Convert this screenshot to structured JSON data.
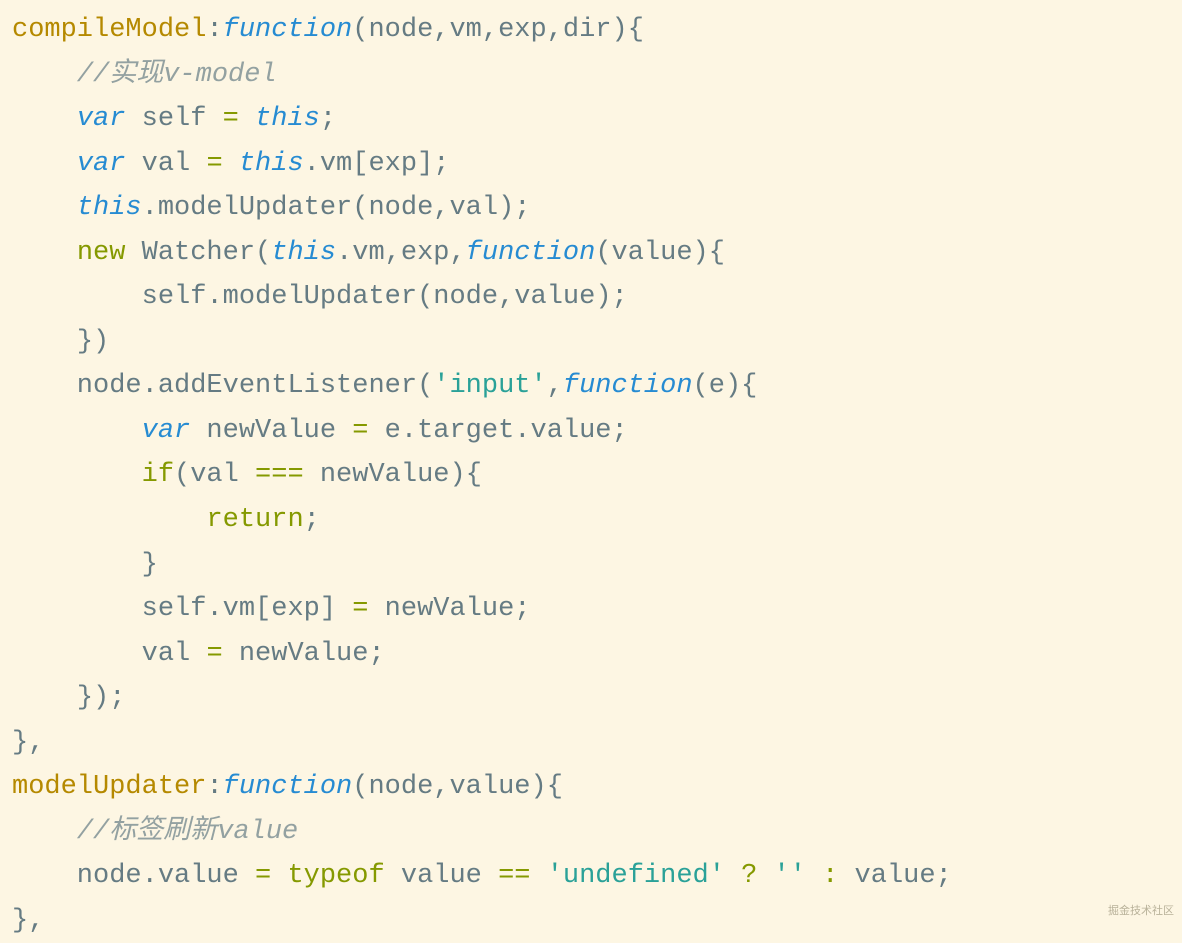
{
  "watermark": "掘金技术社区",
  "tokens": [
    [
      {
        "t": "compileModel",
        "c": "tk-prop"
      },
      {
        "t": ":",
        "c": "tk-pun"
      },
      {
        "t": "function",
        "c": "tk-fn"
      },
      {
        "t": "(",
        "c": "tk-pun"
      },
      {
        "t": "node",
        "c": "tk-name"
      },
      {
        "t": ",",
        "c": "tk-pun"
      },
      {
        "t": "vm",
        "c": "tk-name"
      },
      {
        "t": ",",
        "c": "tk-pun"
      },
      {
        "t": "exp",
        "c": "tk-name"
      },
      {
        "t": ",",
        "c": "tk-pun"
      },
      {
        "t": "dir",
        "c": "tk-name"
      },
      {
        "t": ")",
        "c": "tk-pun"
      },
      {
        "t": "{",
        "c": "tk-pun"
      }
    ],
    [
      {
        "t": "    ",
        "c": "tk-pun"
      },
      {
        "t": "//实现v-model",
        "c": "tk-cmt"
      }
    ],
    [
      {
        "t": "    ",
        "c": "tk-pun"
      },
      {
        "t": "var",
        "c": "tk-var"
      },
      {
        "t": " self ",
        "c": "tk-name"
      },
      {
        "t": "=",
        "c": "tk-kw"
      },
      {
        "t": " ",
        "c": "tk-pun"
      },
      {
        "t": "this",
        "c": "tk-this"
      },
      {
        "t": ";",
        "c": "tk-pun"
      }
    ],
    [
      {
        "t": "    ",
        "c": "tk-pun"
      },
      {
        "t": "var",
        "c": "tk-var"
      },
      {
        "t": " val ",
        "c": "tk-name"
      },
      {
        "t": "=",
        "c": "tk-kw"
      },
      {
        "t": " ",
        "c": "tk-pun"
      },
      {
        "t": "this",
        "c": "tk-this"
      },
      {
        "t": ".",
        "c": "tk-pun"
      },
      {
        "t": "vm",
        "c": "tk-name"
      },
      {
        "t": "[",
        "c": "tk-pun"
      },
      {
        "t": "exp",
        "c": "tk-name"
      },
      {
        "t": "]",
        "c": "tk-pun"
      },
      {
        "t": ";",
        "c": "tk-pun"
      }
    ],
    [
      {
        "t": "    ",
        "c": "tk-pun"
      },
      {
        "t": "this",
        "c": "tk-this"
      },
      {
        "t": ".",
        "c": "tk-pun"
      },
      {
        "t": "modelUpdater",
        "c": "tk-name"
      },
      {
        "t": "(",
        "c": "tk-pun"
      },
      {
        "t": "node",
        "c": "tk-name"
      },
      {
        "t": ",",
        "c": "tk-pun"
      },
      {
        "t": "val",
        "c": "tk-name"
      },
      {
        "t": ")",
        "c": "tk-pun"
      },
      {
        "t": ";",
        "c": "tk-pun"
      }
    ],
    [
      {
        "t": "    ",
        "c": "tk-pun"
      },
      {
        "t": "new",
        "c": "tk-kw"
      },
      {
        "t": " Watcher",
        "c": "tk-name"
      },
      {
        "t": "(",
        "c": "tk-pun"
      },
      {
        "t": "this",
        "c": "tk-this"
      },
      {
        "t": ".",
        "c": "tk-pun"
      },
      {
        "t": "vm",
        "c": "tk-name"
      },
      {
        "t": ",",
        "c": "tk-pun"
      },
      {
        "t": "exp",
        "c": "tk-name"
      },
      {
        "t": ",",
        "c": "tk-pun"
      },
      {
        "t": "function",
        "c": "tk-fn"
      },
      {
        "t": "(",
        "c": "tk-pun"
      },
      {
        "t": "value",
        "c": "tk-name"
      },
      {
        "t": ")",
        "c": "tk-pun"
      },
      {
        "t": "{",
        "c": "tk-pun"
      }
    ],
    [
      {
        "t": "        self",
        "c": "tk-name"
      },
      {
        "t": ".",
        "c": "tk-pun"
      },
      {
        "t": "modelUpdater",
        "c": "tk-name"
      },
      {
        "t": "(",
        "c": "tk-pun"
      },
      {
        "t": "node",
        "c": "tk-name"
      },
      {
        "t": ",",
        "c": "tk-pun"
      },
      {
        "t": "value",
        "c": "tk-name"
      },
      {
        "t": ")",
        "c": "tk-pun"
      },
      {
        "t": ";",
        "c": "tk-pun"
      }
    ],
    [
      {
        "t": "    ",
        "c": "tk-pun"
      },
      {
        "t": "}",
        "c": "tk-pun"
      },
      {
        "t": ")",
        "c": "tk-pun"
      }
    ],
    [
      {
        "t": "    node",
        "c": "tk-name"
      },
      {
        "t": ".",
        "c": "tk-pun"
      },
      {
        "t": "addEventListener",
        "c": "tk-name"
      },
      {
        "t": "(",
        "c": "tk-pun"
      },
      {
        "t": "'input'",
        "c": "tk-str"
      },
      {
        "t": ",",
        "c": "tk-pun"
      },
      {
        "t": "function",
        "c": "tk-fn"
      },
      {
        "t": "(",
        "c": "tk-pun"
      },
      {
        "t": "e",
        "c": "tk-name"
      },
      {
        "t": ")",
        "c": "tk-pun"
      },
      {
        "t": "{",
        "c": "tk-pun"
      }
    ],
    [
      {
        "t": "        ",
        "c": "tk-pun"
      },
      {
        "t": "var",
        "c": "tk-var"
      },
      {
        "t": " newValue ",
        "c": "tk-name"
      },
      {
        "t": "=",
        "c": "tk-kw"
      },
      {
        "t": " e",
        "c": "tk-name"
      },
      {
        "t": ".",
        "c": "tk-pun"
      },
      {
        "t": "target",
        "c": "tk-name"
      },
      {
        "t": ".",
        "c": "tk-pun"
      },
      {
        "t": "value",
        "c": "tk-name"
      },
      {
        "t": ";",
        "c": "tk-pun"
      }
    ],
    [
      {
        "t": "        ",
        "c": "tk-pun"
      },
      {
        "t": "if",
        "c": "tk-kw"
      },
      {
        "t": "(",
        "c": "tk-pun"
      },
      {
        "t": "val ",
        "c": "tk-name"
      },
      {
        "t": "===",
        "c": "tk-kw"
      },
      {
        "t": " newValue",
        "c": "tk-name"
      },
      {
        "t": ")",
        "c": "tk-pun"
      },
      {
        "t": "{",
        "c": "tk-pun"
      }
    ],
    [
      {
        "t": "            ",
        "c": "tk-pun"
      },
      {
        "t": "return",
        "c": "tk-kw"
      },
      {
        "t": ";",
        "c": "tk-pun"
      }
    ],
    [
      {
        "t": "        ",
        "c": "tk-pun"
      },
      {
        "t": "}",
        "c": "tk-pun"
      }
    ],
    [
      {
        "t": "        self",
        "c": "tk-name"
      },
      {
        "t": ".",
        "c": "tk-pun"
      },
      {
        "t": "vm",
        "c": "tk-name"
      },
      {
        "t": "[",
        "c": "tk-pun"
      },
      {
        "t": "exp",
        "c": "tk-name"
      },
      {
        "t": "]",
        "c": "tk-pun"
      },
      {
        "t": " ",
        "c": "tk-pun"
      },
      {
        "t": "=",
        "c": "tk-kw"
      },
      {
        "t": " newValue",
        "c": "tk-name"
      },
      {
        "t": ";",
        "c": "tk-pun"
      }
    ],
    [
      {
        "t": "        val ",
        "c": "tk-name"
      },
      {
        "t": "=",
        "c": "tk-kw"
      },
      {
        "t": " newValue",
        "c": "tk-name"
      },
      {
        "t": ";",
        "c": "tk-pun"
      }
    ],
    [
      {
        "t": "    ",
        "c": "tk-pun"
      },
      {
        "t": "}",
        "c": "tk-pun"
      },
      {
        "t": ")",
        "c": "tk-pun"
      },
      {
        "t": ";",
        "c": "tk-pun"
      }
    ],
    [
      {
        "t": "}",
        "c": "tk-pun"
      },
      {
        "t": ",",
        "c": "tk-pun"
      }
    ],
    [
      {
        "t": "modelUpdater",
        "c": "tk-prop"
      },
      {
        "t": ":",
        "c": "tk-pun"
      },
      {
        "t": "function",
        "c": "tk-fn"
      },
      {
        "t": "(",
        "c": "tk-pun"
      },
      {
        "t": "node",
        "c": "tk-name"
      },
      {
        "t": ",",
        "c": "tk-pun"
      },
      {
        "t": "value",
        "c": "tk-name"
      },
      {
        "t": ")",
        "c": "tk-pun"
      },
      {
        "t": "{",
        "c": "tk-pun"
      }
    ],
    [
      {
        "t": "    ",
        "c": "tk-pun"
      },
      {
        "t": "//标签刷新value",
        "c": "tk-cmt"
      }
    ],
    [
      {
        "t": "    node",
        "c": "tk-name"
      },
      {
        "t": ".",
        "c": "tk-pun"
      },
      {
        "t": "value ",
        "c": "tk-name"
      },
      {
        "t": "=",
        "c": "tk-kw"
      },
      {
        "t": " ",
        "c": "tk-pun"
      },
      {
        "t": "typeof",
        "c": "tk-kw"
      },
      {
        "t": " value ",
        "c": "tk-name"
      },
      {
        "t": "==",
        "c": "tk-kw"
      },
      {
        "t": " ",
        "c": "tk-pun"
      },
      {
        "t": "'undefined'",
        "c": "tk-str"
      },
      {
        "t": " ",
        "c": "tk-pun"
      },
      {
        "t": "?",
        "c": "tk-kw"
      },
      {
        "t": " ",
        "c": "tk-pun"
      },
      {
        "t": "''",
        "c": "tk-str"
      },
      {
        "t": " ",
        "c": "tk-pun"
      },
      {
        "t": ":",
        "c": "tk-kw"
      },
      {
        "t": " value",
        "c": "tk-name"
      },
      {
        "t": ";",
        "c": "tk-pun"
      }
    ],
    [
      {
        "t": "}",
        "c": "tk-pun"
      },
      {
        "t": ",",
        "c": "tk-pun"
      }
    ]
  ]
}
